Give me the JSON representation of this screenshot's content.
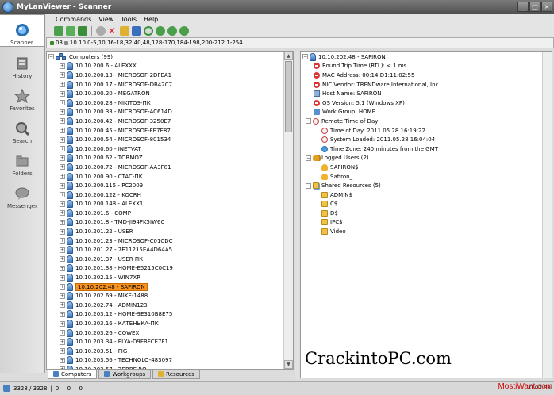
{
  "window": {
    "title": "MyLanViewer - Scanner"
  },
  "sidebar": {
    "items": [
      {
        "label": "Scanner",
        "icon": "scanner-icon"
      },
      {
        "label": "History",
        "icon": "history-icon"
      },
      {
        "label": "Favorites",
        "icon": "star-icon"
      },
      {
        "label": "Search",
        "icon": "search-icon"
      },
      {
        "label": "Folders",
        "icon": "folders-icon"
      },
      {
        "label": "Messenger",
        "icon": "messenger-icon"
      }
    ]
  },
  "menu": [
    "Commands",
    "View",
    "Tools",
    "Help"
  ],
  "address": {
    "count": "03",
    "range": "10.10.0-5,10,16-18,32,40,48,128-170,184-198,200-212.1-254"
  },
  "computers": {
    "root_label": "Computers (99)",
    "items": [
      "10.10.200.6 - ALEXXX",
      "10.10.200.13 - MICROSOF-2DFEA1",
      "10.10.200.17 - MICROSOF-DB42C7",
      "10.10.200.20 - MEGATRON",
      "10.10.200.28 - NIKITOS-ПК",
      "10.10.200.33 - MICROSOF-AC614D",
      "10.10.200.42 - MICROSOF-3250E7",
      "10.10.200.45 - MICROSOF-FE7E87",
      "10.10.200.54 - MICROSOF-801534",
      "10.10.200.60 - INETVAT",
      "10.10.200.62 - TORMOZ",
      "10.10.200.72 - MICROSOF-AA3F81",
      "10.10.200.90 - CTAC-ПК",
      "10.10.200.115 - PC2009",
      "10.10.200.122 - KOCRH",
      "10.10.200.148 - ALEXX1",
      "10.10.201.6 - COMP",
      "10.10.201.8 - TMD-JI94FK5IW6C",
      "10.10.201.22 - USER",
      "10.10.201.23 - MICROSOF-C01CDC",
      "10.10.201.27 - 7E11215EA4D64A5",
      "10.10.201.37 - USER-ПК",
      "10.10.201.38 - HOME-E5215C0C19",
      "10.10.202.15 - WIN7XP",
      "10.10.202.48 - SAFIRON",
      "10.10.202.69 - MIKE-1488",
      "10.10.202.74 - ADMIN123",
      "10.10.203.12 - HOME-9E310B8E75",
      "10.10.203.16 - КАТЕНЬКА-ПК",
      "10.10.203.26 - COWEX",
      "10.10.203.34 - ELYA-D9FBFCE7F1",
      "10.10.203.51 - FIG",
      "10.10.203.56 - TECHNOLO-483097",
      "10.10.203.57 - ZERBE.RO"
    ],
    "selected_index": 24
  },
  "tabs": [
    "Computers",
    "Workgroups",
    "Resources"
  ],
  "details": {
    "header": "10.10.202.48 - SAFIRON",
    "rtt": "Round Trip Time (RTL): < 1 ms",
    "mac": "MAC Address: 00:14:D1:11:02:55",
    "nic": "NIC Vendor: TRENDware International, Inc.",
    "host": "Host Name: SAFIRON",
    "os": "OS Version: 5.1 (Windows XP)",
    "workgroup": "Work Group: HOME",
    "remote_time": "Remote Time of Day",
    "tod": "Time of Day: 2011.05.28  16:19:22",
    "loaded": "System Loaded: 2011.05.28  16:04:04",
    "tz": "Time Zone: 240 minutes from the GMT",
    "logged": "Logged Users (2)",
    "user1": "SAFIRON$",
    "user2": "Safiron_",
    "shared": "Shared Resources (5)",
    "shares": [
      "ADMIN$",
      "C$",
      "D$",
      "IPC$",
      "Video"
    ]
  },
  "status": {
    "counts": "3328 / 3328",
    "c2": "0",
    "c3": "0",
    "c4": "0",
    "duration": "0:01:39"
  },
  "watermark": {
    "main": "CrackintoPC.com",
    "corner": "MostiWant.com"
  }
}
